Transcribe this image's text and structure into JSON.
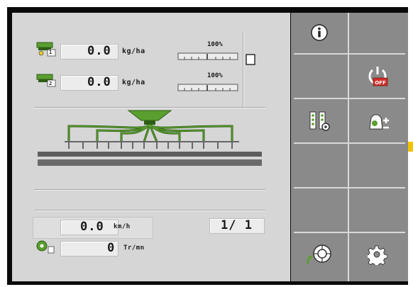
{
  "rate_rows": [
    {
      "value": "0.0",
      "unit": "kg/ha",
      "percent": "100%",
      "badge": "1"
    },
    {
      "value": "0.0",
      "unit": "kg/ha",
      "percent": "100%",
      "badge": "2"
    }
  ],
  "speed": {
    "value": "0.0",
    "unit": "km/h"
  },
  "fan": {
    "value": "0",
    "unit": "Tr/mn"
  },
  "counter": "1/ 1",
  "buttons": [
    {
      "icon": "info-icon"
    },
    {
      "icon": "power-off-icon",
      "badge": "OFF"
    },
    {
      "icon": "machine-settings-icon"
    },
    {
      "icon": "calibration-icon"
    },
    {
      "icon": "rotation-speed-icon"
    },
    {
      "icon": "gear-icon"
    }
  ],
  "colors": {
    "accent_green": "#5a9e2f",
    "panel_bg": "#d6d6d6",
    "button_bg": "#8a8a8a",
    "off_red": "#d0302a",
    "scroll_marker": "#f2c400"
  }
}
